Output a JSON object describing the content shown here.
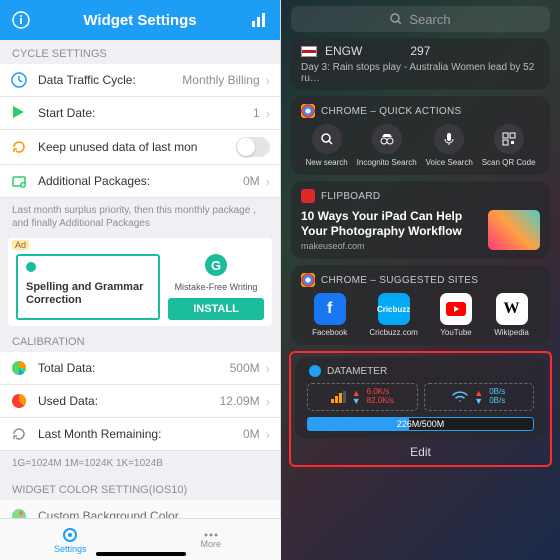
{
  "left": {
    "title": "Widget Settings",
    "sections": {
      "cycle_header": "CYCLE SETTINGS",
      "rows": {
        "traffic": {
          "label": "Data Traffic Cycle:",
          "value": "Monthly Billing"
        },
        "start": {
          "label": "Start Date:",
          "value": "1"
        },
        "keep": {
          "label": "Keep unused data of last mon"
        },
        "addpkg": {
          "label": "Additional Packages:",
          "value": "0M"
        }
      },
      "footnote": "Last month surplus priority, then this monthly package , and finally Additional Packages",
      "calibration_header": "CALIBRATION",
      "calib": {
        "total": {
          "label": "Total Data:",
          "value": "500M"
        },
        "used": {
          "label": "Used Data:",
          "value": "12.09M"
        },
        "last": {
          "label": "Last Month Remaining:",
          "value": "0M"
        }
      },
      "legend": "1G=1024M  1M=1024K  1K=1024B",
      "color_header": "WIDGET COLOR SETTING(IOS10)",
      "custom": {
        "label": "Custom Background Color"
      }
    },
    "ad": {
      "tag": "Ad",
      "headline": "Spelling and Grammar Correction",
      "brand": "Mistake-Free Writing",
      "cta": "INSTALL"
    },
    "tabs": {
      "settings": "Settings",
      "more": "More"
    }
  },
  "right": {
    "search": "Search",
    "cricket": {
      "team": "ENGW",
      "score": "297",
      "line": "Day 3: Rain stops play - Australia Women lead by 52 ru…"
    },
    "chrome_qa": {
      "title": "CHROME – QUICK ACTIONS",
      "items": [
        "New search",
        "Incognito Search",
        "Voice Search",
        "Scan QR Code"
      ]
    },
    "flipboard": {
      "title": "FLIPBOARD",
      "headline": "10 Ways Your iPad Can Help Your Photography Workflow",
      "source": "makeuseof.com"
    },
    "suggested": {
      "title": "CHROME – SUGGESTED SITES",
      "items": [
        "Facebook",
        "Cricbuzz.com",
        "YouTube",
        "Wikipedia"
      ]
    },
    "datameter": {
      "title": "DATAMETER",
      "cell_up": "6.0K/s",
      "cell_down": "82.0K/s",
      "wifi_up": "0B/s",
      "wifi_down": "0B/s",
      "bar": "226M/500M"
    },
    "edit": "Edit"
  }
}
